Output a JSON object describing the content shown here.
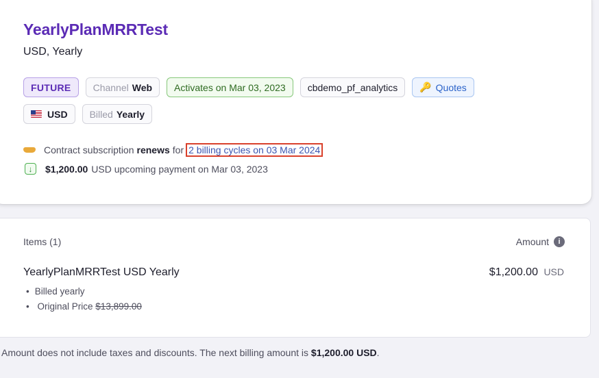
{
  "plan": {
    "title": "YearlyPlanMRRTest",
    "subtitle": "USD, Yearly"
  },
  "tags": {
    "status": "FUTURE",
    "channel_label": "Channel",
    "channel_value": "Web",
    "activates": "Activates on Mar 03, 2023",
    "site": "cbdemo_pf_analytics",
    "quotes_icon": "key-icon",
    "quotes": "Quotes",
    "currency_icon": "us-flag-icon",
    "currency": "USD",
    "billed_label": "Billed",
    "billed_value": "Yearly"
  },
  "renewal": {
    "icon": "handshake-icon",
    "prefix": "Contract subscription",
    "bold": "renews",
    "for": "for",
    "highlight": "2 billing cycles on 03 Mar 2024"
  },
  "payment": {
    "icon": "download-arrow-icon",
    "amount": "$1,200.00",
    "text": "USD upcoming payment on Mar 03, 2023"
  },
  "items": {
    "header": "Items (1)",
    "amount_header": "Amount",
    "info_icon": "i",
    "rows": [
      {
        "name": "YearlyPlanMRRTest USD Yearly",
        "price": "$1,200.00",
        "currency": "USD",
        "details": [
          "Billed yearly",
          "Original Price"
        ],
        "original_price": "$13,899.00"
      }
    ]
  },
  "footer": {
    "text": "Amount does not include taxes and discounts. The next billing amount is",
    "amount": "$1,200.00 USD",
    "end": "."
  },
  "colors": {
    "title": "#5b2bb5",
    "highlight_border": "#d9402b",
    "background": "#f2f2f7"
  }
}
